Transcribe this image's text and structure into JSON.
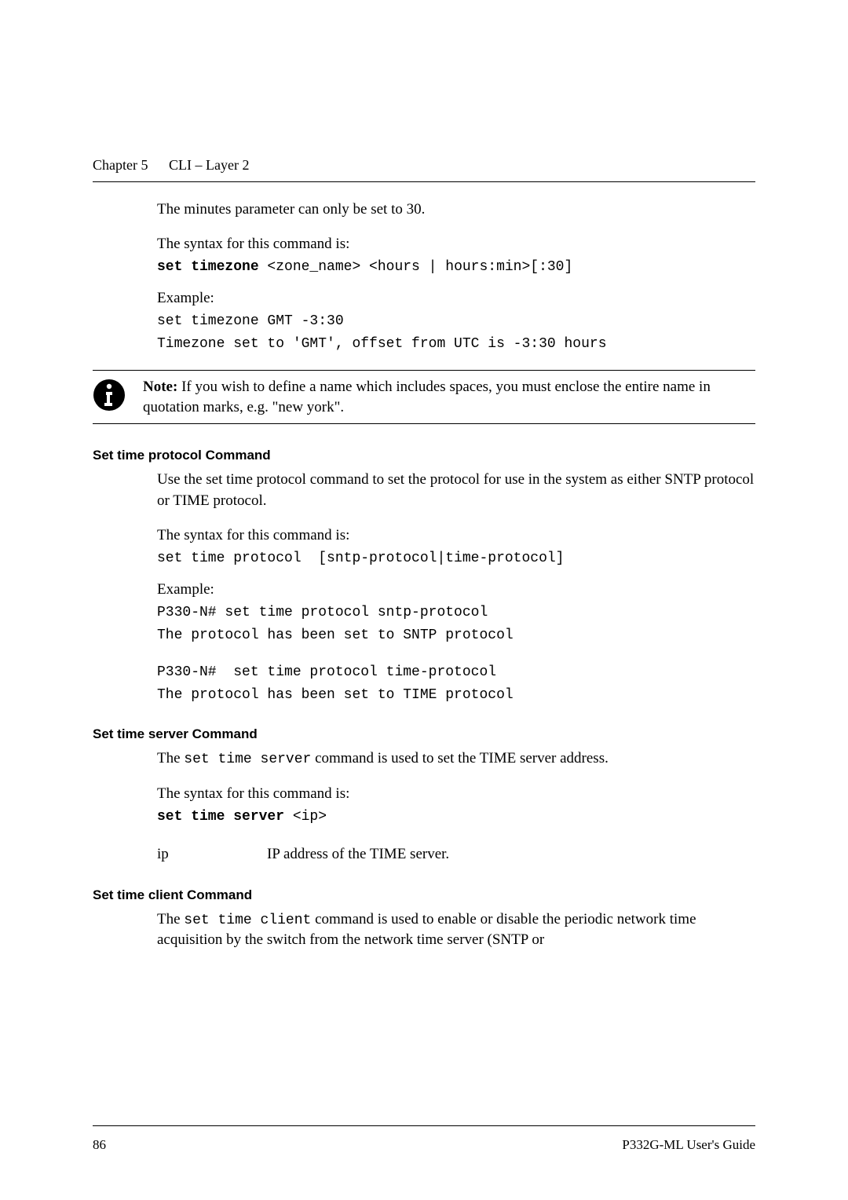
{
  "header": {
    "chapter_label": "Chapter 5",
    "chapter_title": "CLI – Layer 2"
  },
  "intro": {
    "minutes_note": "The minutes parameter can only be set to 30.",
    "syntax_label": "The syntax for this command is:",
    "syntax_cmd_bold": "set timezone",
    "syntax_cmd_rest": " <zone_name> <hours | hours:min>[:30]",
    "example_label": "Example:",
    "example_line1": "set timezone GMT -3:30",
    "example_line2": "Timezone set to 'GMT', offset from UTC is -3:30 hours"
  },
  "note": {
    "label": "Note:",
    "text": "  If you wish to define a name which includes spaces, you must enclose the entire name in quotation marks, e.g. \"new york\"."
  },
  "section_protocol": {
    "heading": "Set time protocol Command",
    "desc": "Use the set time protocol command to set the protocol for use in the system as either SNTP protocol or TIME protocol.",
    "syntax_label": "The syntax for this command is:",
    "syntax_cmd": "set time protocol  [sntp-protocol|time-protocol]",
    "example_label": "Example:",
    "ex1_line1": "P330-N# set time protocol sntp-protocol",
    "ex1_line2": "The protocol has been set to SNTP protocol",
    "ex2_line1": "P330-N#  set time protocol time-protocol",
    "ex2_line2": "The protocol has been set to TIME protocol"
  },
  "section_server": {
    "heading": "Set time server Command",
    "desc_pre": "The ",
    "desc_code": "set time server",
    "desc_post": " command is used to set the TIME server address.",
    "syntax_label": "The syntax for this command is:",
    "syntax_cmd_bold": "set time server",
    "syntax_cmd_rest": " <ip>",
    "param_term": " ip",
    "param_desc": "IP address of the TIME server."
  },
  "section_client": {
    "heading": "Set time client Command",
    "desc_pre": "The ",
    "desc_code": "set time client",
    "desc_post": " command is used to enable or disable the periodic network time acquisition by the switch from the network time server (SNTP or"
  },
  "footer": {
    "page_number": "86",
    "doc_title": "P332G-ML User's Guide"
  }
}
